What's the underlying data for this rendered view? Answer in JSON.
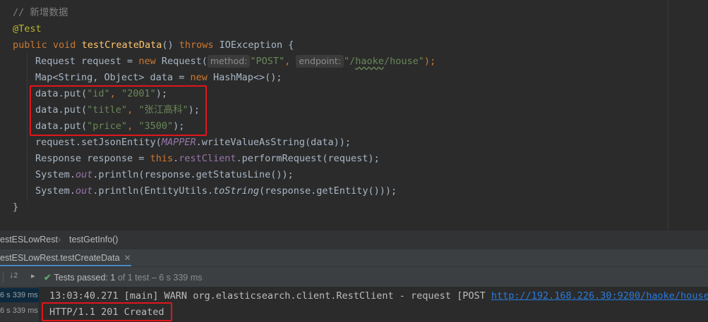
{
  "code": {
    "comment": "// 新增数据",
    "annotation": "@Test",
    "decl": {
      "kw_public": "public",
      "kw_void": "void",
      "method": "testCreateData",
      "params": "() ",
      "kw_throws": "throws",
      "exception": " IOException {"
    },
    "l4": {
      "a": "Request request = ",
      "kw_new": "new",
      "b": " Request(",
      "hint_method": "method:",
      "s_post": "\"POST\"",
      "comma": ", ",
      "hint_endpoint": "endpoint:",
      "s_ep_a": "\"/",
      "s_ep_b": "haoke",
      "s_ep_c": "/house\"",
      "end": ");"
    },
    "l5": {
      "a": "Map<String, Object> data = ",
      "kw_new": "new",
      "b": " HashMap<>();"
    },
    "l6": {
      "a": "data.put(",
      "k": "\"id\"",
      "c": ", ",
      "v": "\"2001\"",
      "e": ");"
    },
    "l7": {
      "a": "data.put(",
      "k": "\"title\"",
      "c": ", ",
      "v": "\"张江高科\"",
      "e": ");"
    },
    "l8": {
      "a": "data.put(",
      "k": "\"price\"",
      "c": ", ",
      "v": "\"3500\"",
      "e": ");"
    },
    "l9": {
      "a": "request.setJsonEntity(",
      "f": "MAPPER",
      "b": ".writeValueAsString(data));"
    },
    "l10": {
      "a": "Response response = ",
      "kw_this": "this",
      "dot": ".",
      "f": "restClient",
      "b": ".performRequest(request);"
    },
    "l11": {
      "a": "System.",
      "f": "out",
      "b": ".println(response.getStatusLine());"
    },
    "l12": {
      "a": "System.",
      "f": "out",
      "b": ".println(EntityUtils.",
      "m": "toString",
      "c": "(response.getEntity()));"
    },
    "close_brace": "}"
  },
  "breadcrumb": {
    "class_name": "estESLowRest",
    "method": "testGetInfo()"
  },
  "run_tab": {
    "label": "estESLowRest.testCreateData",
    "close": "✕"
  },
  "test_toolbar": {
    "passed_label": "Tests passed:",
    "passed_count": "1",
    "of_total": "of 1 test",
    "duration": "– 6 s 339 ms"
  },
  "tree": {
    "time1": "6 s 339 ms",
    "time2": "6 s 339 ms"
  },
  "console": {
    "log_prefix": "13:03:40.271 [main] WARN org.elasticsearch.client.RestClient - request [POST ",
    "log_url": "http://192.168.226.30:9200/haoke/house",
    "log_suffix": "]",
    "status_line": "HTTP/1.1 201 Created"
  },
  "icons": {
    "sort": "sort-icon",
    "check": "check-icon",
    "collapse": "collapse-icon"
  },
  "colors": {
    "editor_bg": "#2b2b2b",
    "highlight": "#e0161b",
    "pass_green": "#59a869",
    "link": "#287bde"
  }
}
